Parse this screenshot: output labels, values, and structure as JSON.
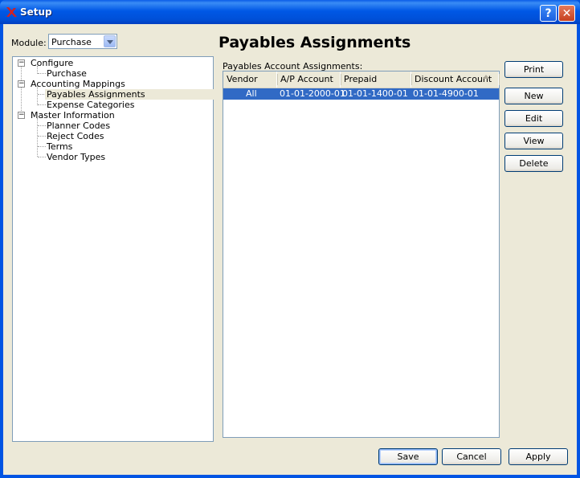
{
  "window": {
    "title": "Setup"
  },
  "module": {
    "label": "Module:",
    "value": "Purchase"
  },
  "tree": {
    "configure": "Configure",
    "purchase": "Purchase",
    "accounting_mappings": "Accounting Mappings",
    "payables_assignments": "Payables Assignments",
    "expense_categories": "Expense Categories",
    "master_information": "Master Information",
    "planner_codes": "Planner Codes",
    "reject_codes": "Reject Codes",
    "terms": "Terms",
    "vendor_types": "Vendor Types",
    "selected": "Payables Assignments"
  },
  "panel": {
    "title": "Payables Assignments",
    "table_label": "Payables Account Assignments:",
    "columns": [
      "Vendor Type",
      "A/P Account",
      "Prepaid Account",
      "Discount Account"
    ],
    "rows": [
      [
        "All",
        "01-01-2000-01",
        "01-01-1400-01",
        "01-01-4900-01"
      ]
    ]
  },
  "buttons": {
    "print": "Print",
    "new": "New",
    "edit": "Edit",
    "view": "View",
    "delete": "Delete",
    "save": "Save",
    "cancel": "Cancel",
    "apply": "Apply"
  },
  "colors": {
    "titlebar": "#0054e3",
    "selection": "#316ac5",
    "face": "#ece9d8"
  },
  "icons": {
    "app": "x-logo-icon",
    "help": "help-icon",
    "close": "close-icon",
    "sort": "sort-ascending-icon"
  }
}
